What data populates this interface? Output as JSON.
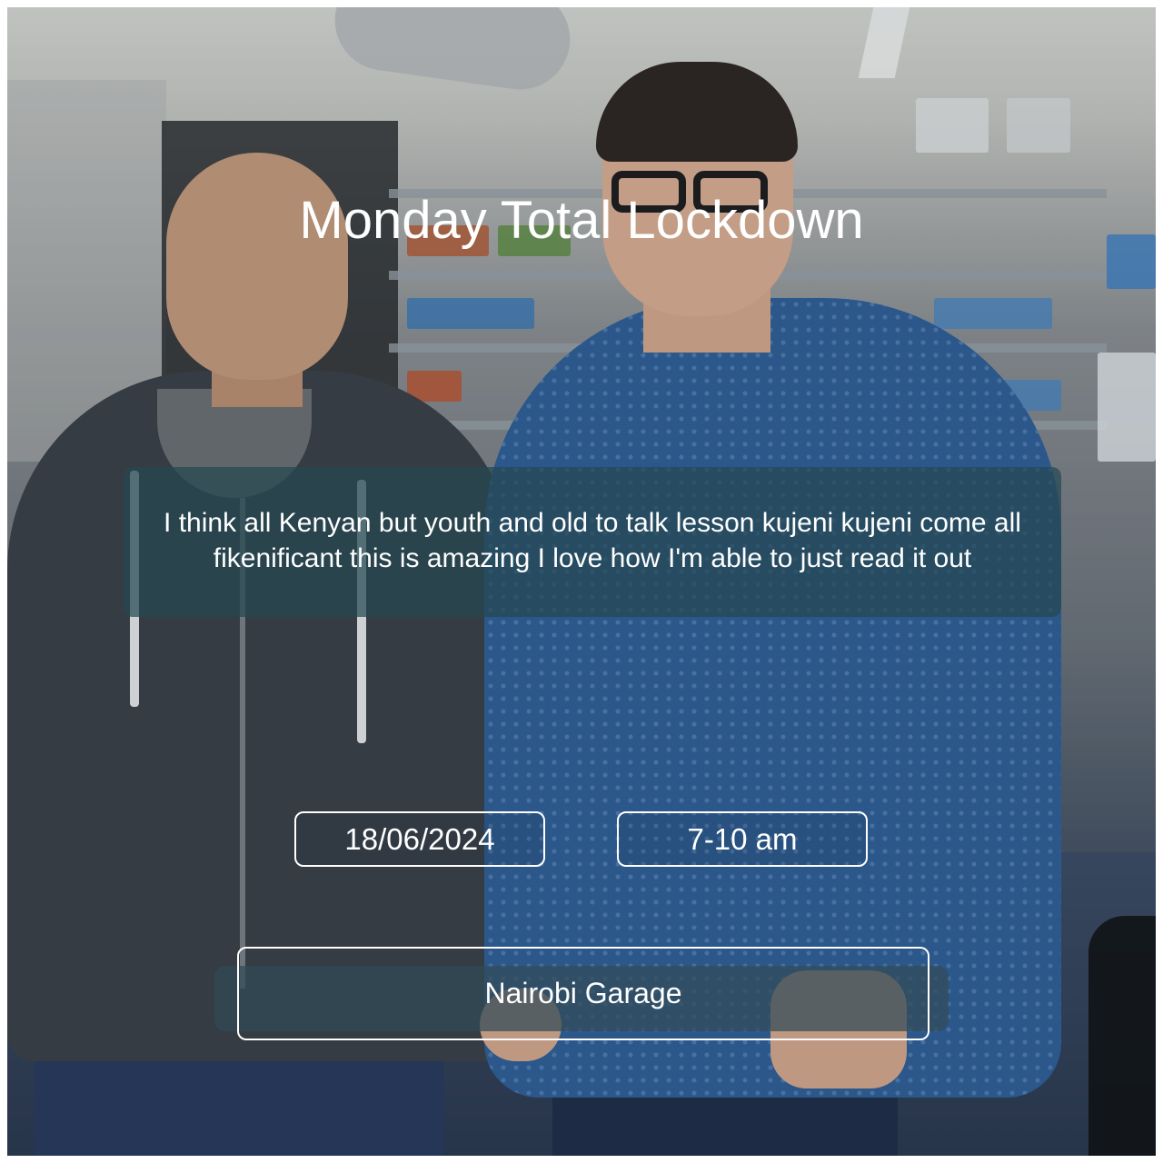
{
  "card": {
    "title": "Monday Total Lockdown",
    "message": "I think all Kenyan but youth and old to talk lesson kujeni kujeni come all fikenificant this is amazing I love how I'm able to just read it out",
    "date": "18/06/2024",
    "time": "7-10 am",
    "location": "Nairobi Garage"
  },
  "colors": {
    "text": "#ffffff",
    "message_box": "#264852",
    "border": "#ffffff"
  }
}
